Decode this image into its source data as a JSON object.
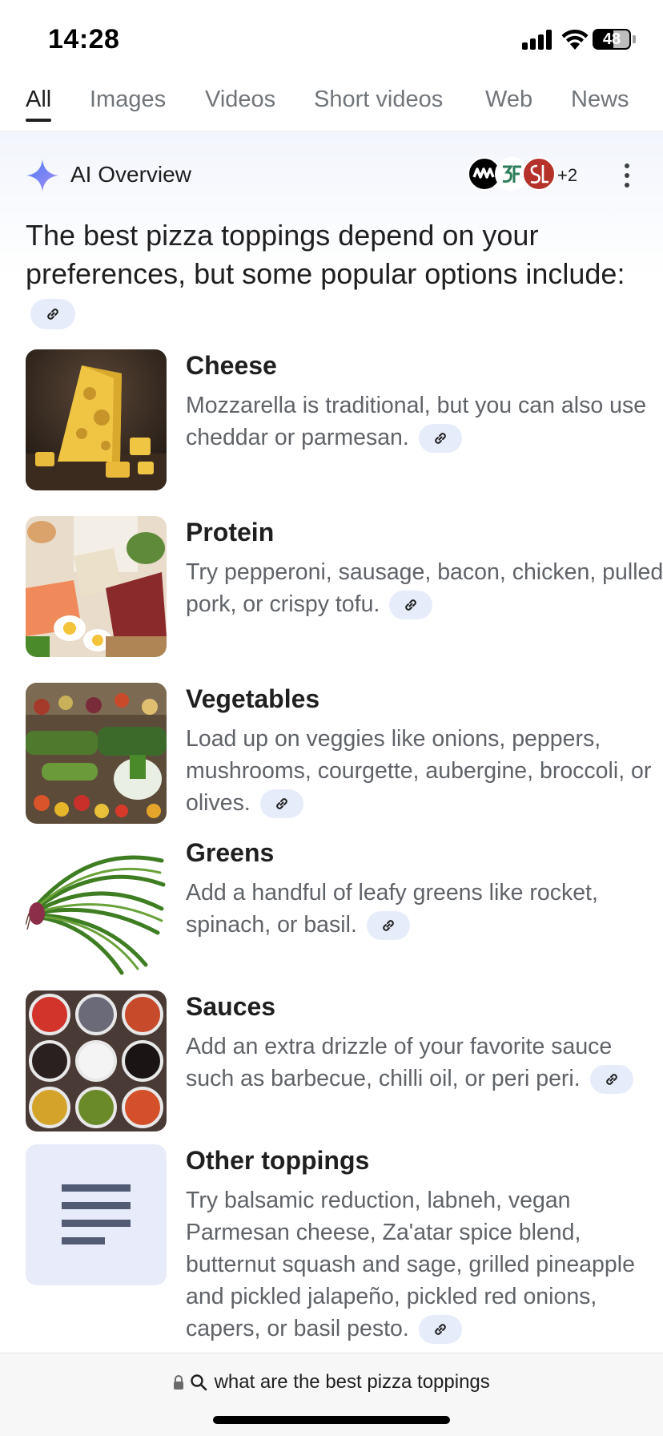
{
  "status": {
    "time": "14:28",
    "battery": "48"
  },
  "tabs": [
    {
      "label": "All",
      "active": true
    },
    {
      "label": "Images"
    },
    {
      "label": "Videos"
    },
    {
      "label": "Short videos"
    },
    {
      "label": "Web"
    },
    {
      "label": "News"
    }
  ],
  "overview": {
    "title": "AI Overview",
    "sources_more": "+2",
    "intro": "The best pizza toppings depend on your preferences, but some popular options include:"
  },
  "items": [
    {
      "title": "Cheese",
      "desc": "Mozzarella is traditional, but you can also use cheddar or parmesan."
    },
    {
      "title": "Protein",
      "desc": "Try pepperoni, sausage, bacon, chicken, pulled pork, or crispy tofu."
    },
    {
      "title": "Vegetables",
      "desc": "Load up on veggies like onions, peppers, mushrooms, courgette, aubergine, broccoli, or olives."
    },
    {
      "title": "Greens",
      "desc": "Add a handful of leafy greens like rocket, spinach, or basil."
    },
    {
      "title": "Sauces",
      "desc": "Add an extra drizzle of your favorite sauce such as barbecue, chilli oil, or peri peri."
    },
    {
      "title": "Other toppings",
      "desc": "Try balsamic reduction, labneh, vegan Parmesan cheese, Za'atar spice blend, butternut squash and sage, grilled pineapple and pickled jalapeño, pickled red onions, capers, or basil pesto."
    }
  ],
  "address_bar": {
    "query": "what are the best pizza toppings"
  },
  "icons": {
    "sparkle": "sparkle-icon",
    "link": "link-icon",
    "lock": "lock-icon",
    "search": "search-icon",
    "more": "more-vert-icon"
  }
}
